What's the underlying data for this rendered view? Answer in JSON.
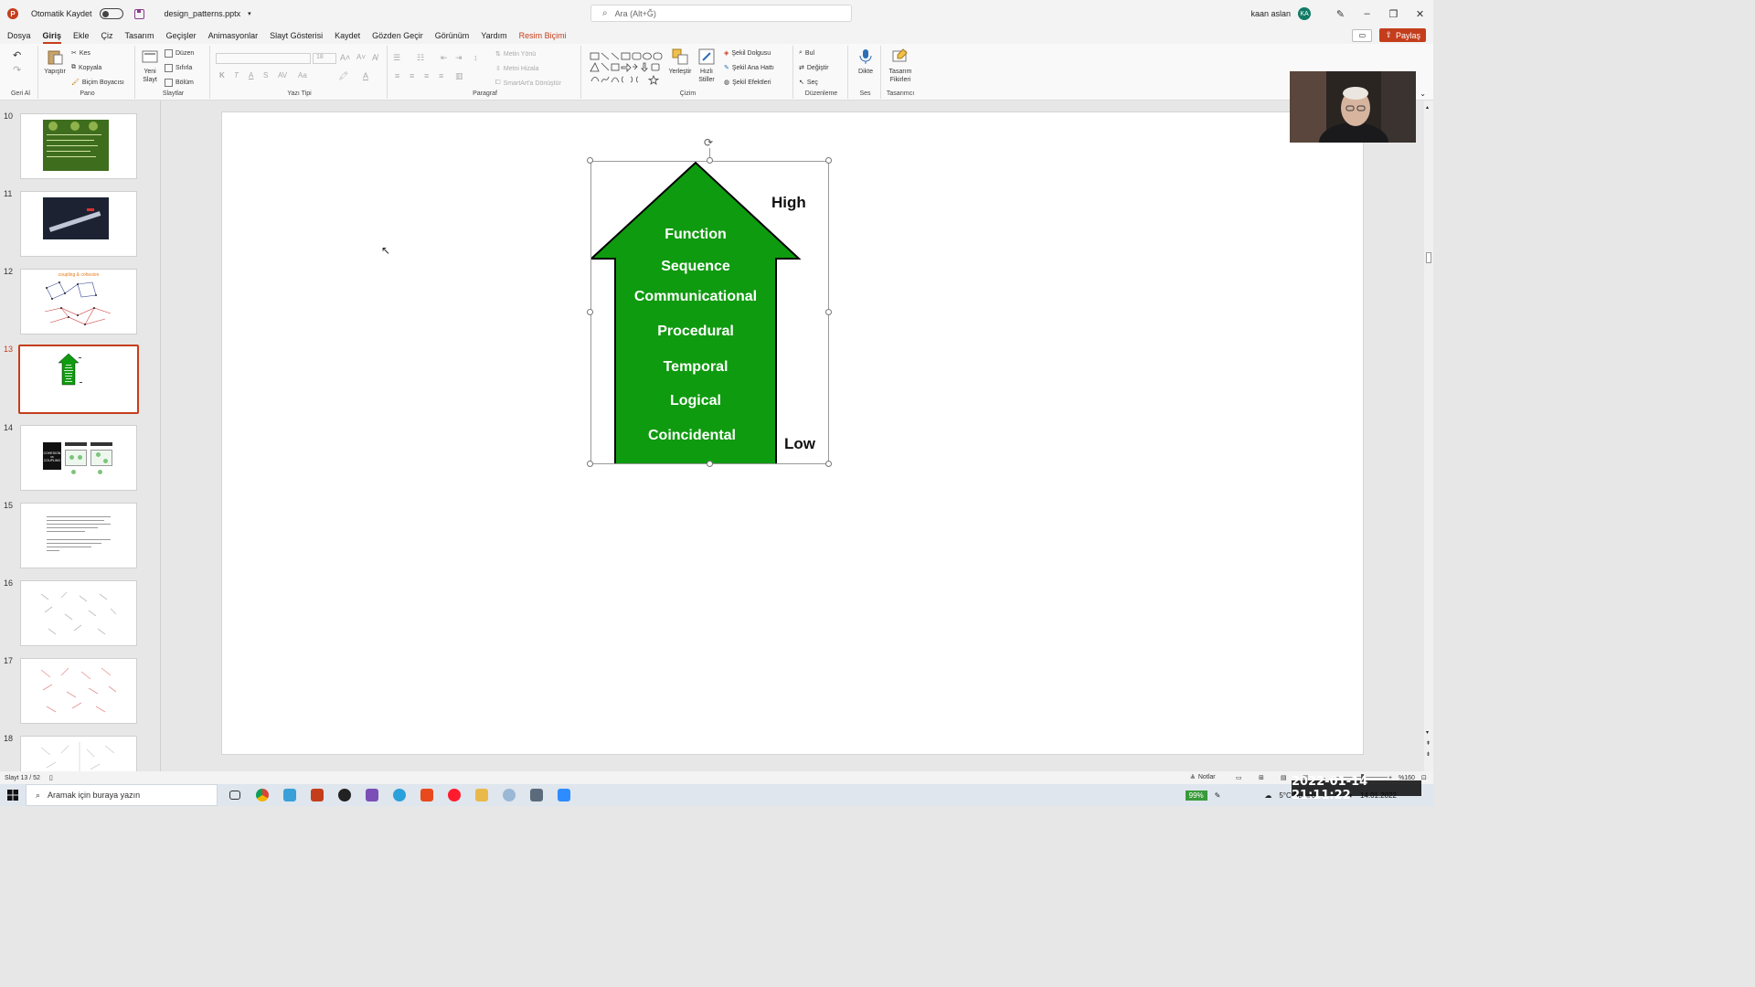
{
  "titlebar": {
    "autosave_label": "Otomatik Kaydet",
    "filename": "design_patterns.pptx",
    "search_placeholder": "Ara (Alt+Ğ)",
    "username": "kaan aslan",
    "avatar_initials": "KA"
  },
  "menu": {
    "tabs": [
      "Dosya",
      "Giriş",
      "Ekle",
      "Çiz",
      "Tasarım",
      "Geçişler",
      "Animasyonlar",
      "Slayt Gösterisi",
      "Kaydet",
      "Gözden Geçir",
      "Görünüm",
      "Yardım",
      "Resim Biçimi"
    ],
    "active_tab": "Giriş",
    "share_label": "Paylaş"
  },
  "ribbon": {
    "undo_group": "Geri Al",
    "clipboard": {
      "group": "Pano",
      "paste": "Yapıştır",
      "cut": "Kes",
      "copy": "Kopyala",
      "format_painter": "Biçim Boyacısı"
    },
    "slides": {
      "group": "Slaytlar",
      "new_slide_1": "Yeni",
      "new_slide_2": "Slayt",
      "layout": "Düzen",
      "reset": "Sıfırla",
      "section": "Bölüm"
    },
    "font": {
      "group": "Yazı Tipi",
      "size": "18",
      "bold": "K",
      "italic": "T",
      "underline": "A",
      "strike": "S"
    },
    "paragraph": {
      "group": "Paragraf",
      "text_direction": "Metin Yönü",
      "align_text": "Metni Hizala",
      "smartart": "SmartArt'a Dönüştür"
    },
    "drawing": {
      "group": "Çizim",
      "arrange": "Yerleştir",
      "quick_styles_1": "Hızlı",
      "quick_styles_2": "Stiller",
      "shape_fill": "Şekil Dolgusu",
      "shape_outline": "Şekil Ana Hattı",
      "shape_effects": "Şekil Efektleri"
    },
    "editing": {
      "group": "Düzenleme",
      "find": "Bul",
      "replace": "Değiştir",
      "select": "Seç"
    },
    "voice": {
      "group": "Ses",
      "dictate": "Dikte"
    },
    "designer": {
      "group": "Tasarımcı",
      "ideas_1": "Tasarım",
      "ideas_2": "Fikirleri"
    }
  },
  "thumbnails": {
    "numbers": [
      "10",
      "11",
      "12",
      "13",
      "14",
      "15",
      "16",
      "17",
      "18"
    ],
    "active": "13",
    "slide12_title": "coupling & cohesion",
    "slide14_text": "COHESION vs COUPLING"
  },
  "slide": {
    "levels": [
      "Function",
      "Sequence",
      "Communicational",
      "Procedural",
      "Temporal",
      "Logical",
      "Coincidental"
    ],
    "high_label": "High",
    "low_label": "Low",
    "arrow_color": "#0f9b0f"
  },
  "statusbar": {
    "slide_counter": "Slayt 13 / 52",
    "notes_label": "Notlar",
    "zoom": "%160"
  },
  "taskbar": {
    "search_placeholder": "Aramak için buraya yazın",
    "battery": "99%",
    "weather": "5°C Bulutlu",
    "date": "14.01.2022"
  },
  "overlay_timestamp": "2022-01-14 21:11:22"
}
